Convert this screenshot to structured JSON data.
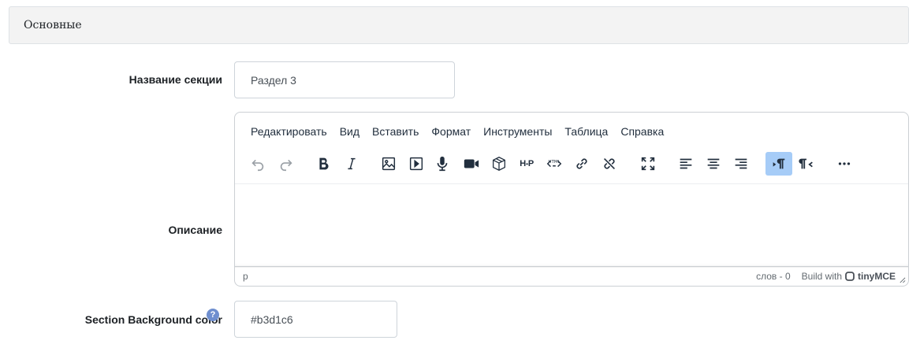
{
  "section": {
    "title": "Основные"
  },
  "fields": {
    "name": {
      "label": "Название секции",
      "value": "Раздел 3"
    },
    "description": {
      "label": "Описание"
    },
    "bg_color": {
      "label": "Section Background color",
      "value": "#b3d1c6",
      "help": "?"
    }
  },
  "editor": {
    "menu": [
      "Редактировать",
      "Вид",
      "Вставить",
      "Формат",
      "Инструменты",
      "Таблица",
      "Справка"
    ],
    "toolbar": {
      "h5p": "H-P",
      "html": "HTML"
    },
    "status": {
      "path": "p",
      "word_count": "слов - 0",
      "build_with": "Build with",
      "brand": "tinyMCE"
    }
  },
  "colors": {
    "accent": "#a6ccf7",
    "help": "#6f8fcf",
    "header_bg": "#f3f3f3"
  }
}
